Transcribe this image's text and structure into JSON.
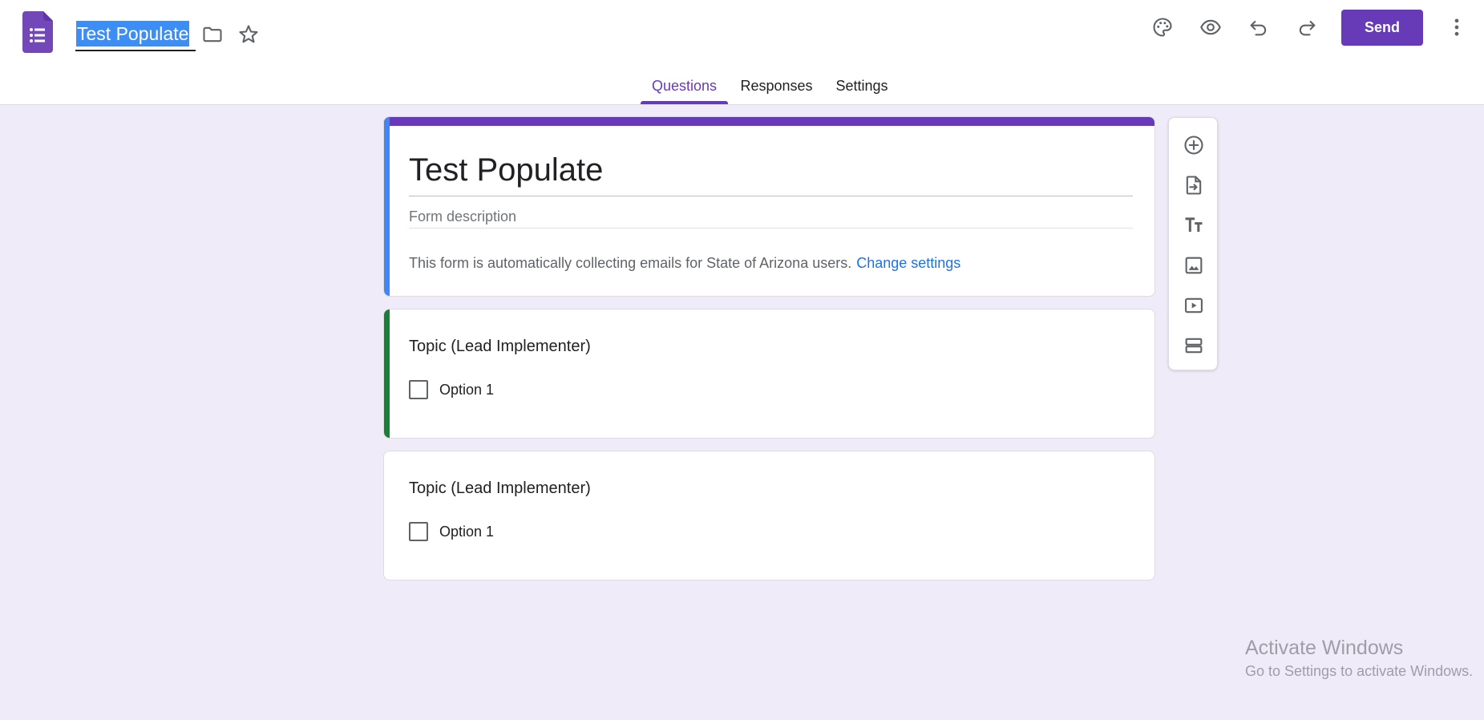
{
  "header": {
    "doc_title": "Test Populate",
    "send_label": "Send"
  },
  "tabs": [
    {
      "label": "Questions",
      "active": true
    },
    {
      "label": "Responses",
      "active": false
    },
    {
      "label": "Settings",
      "active": false
    }
  ],
  "form": {
    "title": "Test Populate",
    "description_placeholder": "Form description",
    "email_notice": "This form is automatically collecting emails for State of Arizona users.",
    "change_settings_link": "Change settings"
  },
  "questions": [
    {
      "title": "Topic (Lead Implementer)",
      "options": [
        "Option 1"
      ],
      "selected": true
    },
    {
      "title": "Topic (Lead Implementer)",
      "options": [
        "Option 1"
      ],
      "selected": false
    }
  ],
  "toolbar": {
    "icons": [
      "add-question-icon",
      "import-questions-icon",
      "add-title-icon",
      "add-image-icon",
      "add-video-icon",
      "add-section-icon"
    ]
  },
  "watermark": {
    "title": "Activate Windows",
    "subtitle": "Go to Settings to activate Windows."
  },
  "colors": {
    "brand": "#673ab7",
    "background": "#f0ebf8",
    "title_card_accent": "#4285f4",
    "selected_question_accent": "#188038",
    "link": "#1a73e8"
  }
}
